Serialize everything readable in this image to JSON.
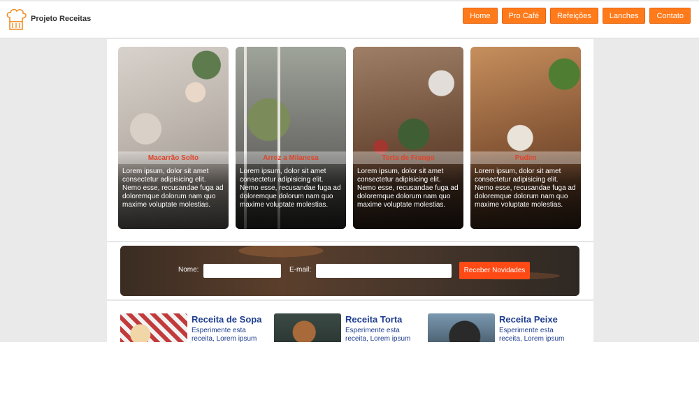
{
  "brand": {
    "name": "Projeto Receitas",
    "logo_icon": "chef-hat-icon"
  },
  "nav": [
    {
      "label": "Home"
    },
    {
      "label": "Pro Café"
    },
    {
      "label": "Refeições"
    },
    {
      "label": "Lanches"
    },
    {
      "label": "Contato"
    }
  ],
  "cards": [
    {
      "title": "Macarrão Solto",
      "description": "Lorem ipsum, dolor sit amet consectetur adipisicing elit. Nemo esse, recusandae fuga ad doloremque dolorum nam quo maxime voluptate molestias."
    },
    {
      "title": "Arroz a Milanesa",
      "description": "Lorem ipsum, dolor sit amet consectetur adipisicing elit. Nemo esse, recusandae fuga ad doloremque dolorum nam quo maxime voluptate molestias."
    },
    {
      "title": "Torta de Frango",
      "description": "Lorem ipsum, dolor sit amet consectetur adipisicing elit. Nemo esse, recusandae fuga ad doloremque dolorum nam quo maxime voluptate molestias."
    },
    {
      "title": "Pudim",
      "description": "Lorem ipsum, dolor sit amet consectetur adipisicing elit. Nemo esse, recusandae fuga ad doloremque dolorum nam quo maxime voluptate molestias."
    }
  ],
  "newsletter": {
    "name_label": "Nome:",
    "name_value": "",
    "email_label": "E-mail:",
    "email_value": "",
    "button_label": "Receber Novidades"
  },
  "recipes": [
    {
      "title": "Receita de Sopa",
      "description": "Esperimente esta receita, Lorem ipsum"
    },
    {
      "title": "Receita Torta",
      "description": "Esperimente esta receita, Lorem ipsum"
    },
    {
      "title": "Receita Peixe",
      "description": "Esperimente esta receita, Lorem ipsum"
    }
  ],
  "colors": {
    "nav_button": "#ff7a1a",
    "subscribe_button": "#ff4a16",
    "card_title": "#e0442a",
    "recipe_text": "#1e3d8f"
  }
}
